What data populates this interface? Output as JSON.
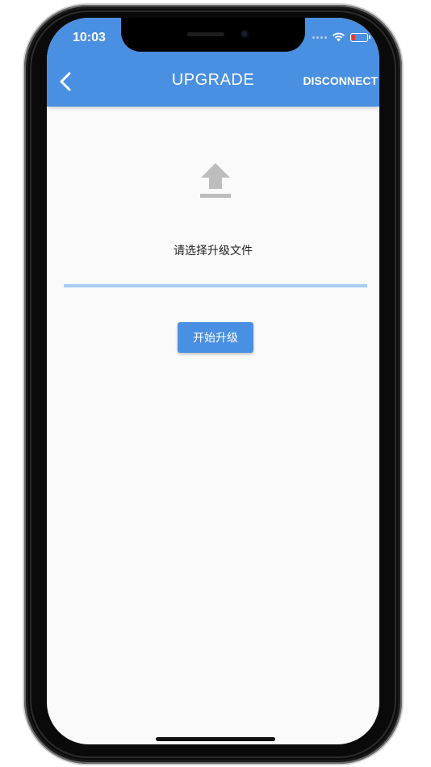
{
  "status_bar": {
    "time": "10:03",
    "icons": [
      "signal-dots-icon",
      "wifi-icon",
      "battery-icon"
    ]
  },
  "app_bar": {
    "back_icon": "chevron-left-icon",
    "title": "UPGRADE",
    "action_label": "DISCONNECT"
  },
  "content": {
    "upload_icon": "upload-icon",
    "prompt": "请选择升级文件",
    "progress_percent": 0,
    "start_button_label": "开始升级"
  },
  "colors": {
    "primary": "#4a90e2",
    "progress_track": "#a6cdf2",
    "icon_gray": "#bdbdbd",
    "background": "#fafafa"
  }
}
